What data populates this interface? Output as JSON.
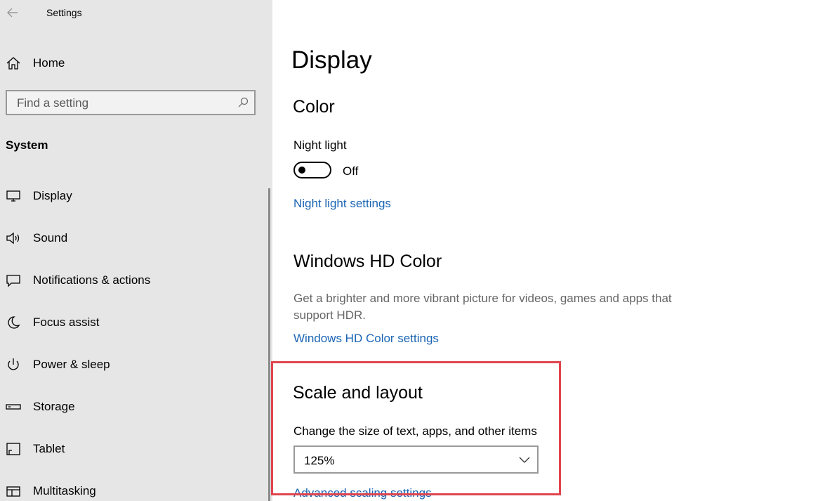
{
  "window": {
    "title": "Settings"
  },
  "sidebar": {
    "home_label": "Home",
    "search_placeholder": "Find a setting",
    "section_title": "System",
    "items": [
      {
        "label": "Display",
        "icon": "monitor-icon"
      },
      {
        "label": "Sound",
        "icon": "speaker-icon"
      },
      {
        "label": "Notifications & actions",
        "icon": "message-icon"
      },
      {
        "label": "Focus assist",
        "icon": "moon-icon"
      },
      {
        "label": "Power & sleep",
        "icon": "power-icon"
      },
      {
        "label": "Storage",
        "icon": "storage-icon"
      },
      {
        "label": "Tablet",
        "icon": "tablet-icon"
      },
      {
        "label": "Multitasking",
        "icon": "multitasking-icon"
      }
    ]
  },
  "main": {
    "title": "Display",
    "color": {
      "heading": "Color",
      "night_light_label": "Night light",
      "night_light_state": "Off",
      "night_light_link": "Night light settings"
    },
    "hdr": {
      "heading": "Windows HD Color",
      "description": "Get a brighter and more vibrant picture for videos, games and apps that support HDR.",
      "link": "Windows HD Color settings"
    },
    "scale": {
      "heading": "Scale and layout",
      "size_label": "Change the size of text, apps, and other items",
      "size_value": "125%",
      "advanced_link": "Advanced scaling settings"
    }
  },
  "colors": {
    "sidebar_bg": "#e6e6e6",
    "link": "#1a64b3",
    "highlight": "#e0454f"
  }
}
